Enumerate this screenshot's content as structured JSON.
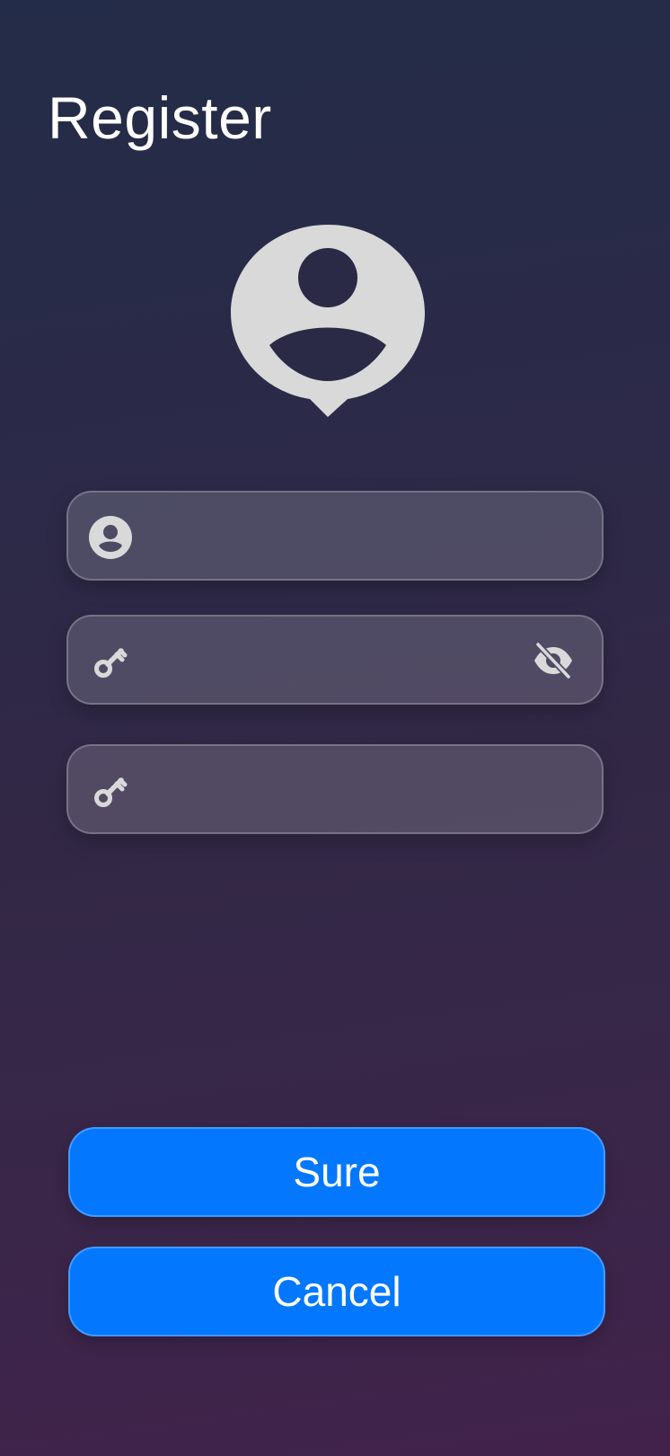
{
  "page": {
    "title": "Register"
  },
  "avatar": {
    "icon": "user-avatar-pin-icon",
    "color": "#d9d9d9"
  },
  "form": {
    "username": {
      "icon": "account-circle-icon",
      "value": "",
      "placeholder": ""
    },
    "password": {
      "icon": "key-icon",
      "value": "",
      "placeholder": "",
      "toggle_icon": "eye-off-icon"
    },
    "confirm_password": {
      "icon": "key-icon",
      "value": "",
      "placeholder": ""
    }
  },
  "actions": {
    "sure_label": "Sure",
    "cancel_label": "Cancel"
  },
  "colors": {
    "accent": "#0378ff",
    "icon": "#d9d9d9",
    "background_top": "#232c48",
    "background_bottom": "#42224b"
  }
}
